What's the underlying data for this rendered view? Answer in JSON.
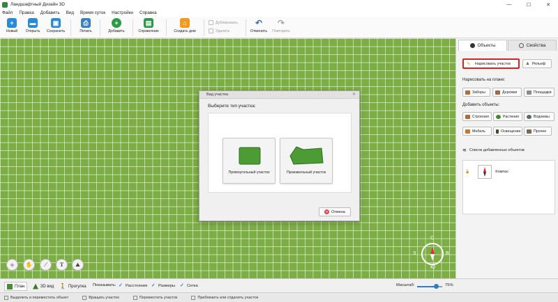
{
  "window": {
    "title": "Ландшафтный Дизайн 3D",
    "minimize": "—",
    "maximize": "☐",
    "close": "✕"
  },
  "menu": [
    "Файл",
    "Правка",
    "Добавить",
    "Вид",
    "Время суток",
    "Настройки",
    "Справка"
  ],
  "toolbar": {
    "new": "Новый",
    "open": "Открыть",
    "save": "Сохранить",
    "print": "Печать",
    "add": "Добавить",
    "reference": "Справочник",
    "build_house": "Создать дом",
    "duplicate": "Дублировать",
    "delete": "Удалить",
    "undo": "Отменить",
    "redo": "Повторить"
  },
  "dialog": {
    "title": "Вид участка",
    "close": "✕",
    "prompt": "Выберите тип участка:",
    "rect_option": "Прямоугольный участок",
    "free_option": "Произвольный участок",
    "cancel": "Отмена",
    "cancel_icon": "x-icon"
  },
  "right_panel": {
    "tab_objects": "Объекты",
    "tab_properties": "Свойства",
    "draw_plot": "Нарисовать участок",
    "relief": "Рельеф",
    "draw_on_plan_title": "Нарисовать на плане:",
    "fences": "Заборы",
    "paths": "Дорожки",
    "areas": "Площадки",
    "add_objects_title": "Добавить объекты:",
    "buildings": "Строения",
    "plants": "Растения",
    "ponds": "Водоемы",
    "furniture": "Мебель",
    "lighting": "Освещение",
    "other": "Прочее",
    "list_title": "Список добавленных объектов",
    "list_items": [
      "Компас"
    ]
  },
  "compass": {
    "n": "С",
    "s": "Ю",
    "w": "З",
    "e": "В"
  },
  "viewbar": {
    "plan": "План",
    "view3d": "3D вид",
    "walk": "Прогулка",
    "show": "Показывать:",
    "distances": "Расстояния",
    "sizes": "Размеры",
    "grid": "Сетка",
    "scale_label": "Масштаб:",
    "scale_value": "75%",
    "scale_level": 0.75
  },
  "statusbar": [
    "Выделить и переместить объект",
    "Вращать участок",
    "Переместить участок",
    "Приблизить или отдалить участок"
  ],
  "colors": {
    "accent_green": "#2e8b3a",
    "canvas": "#7cae45",
    "highlight": "#e02020"
  }
}
